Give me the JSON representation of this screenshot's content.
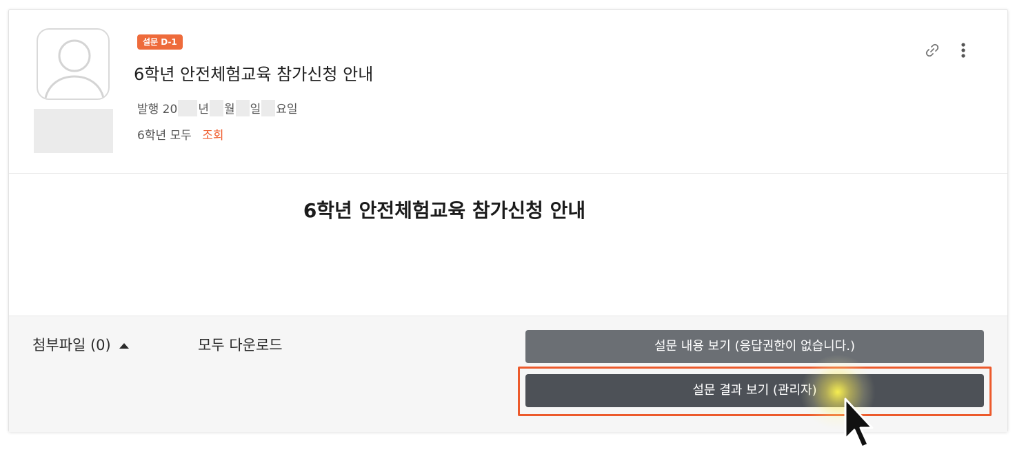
{
  "post": {
    "badge": "설문 D-1",
    "title": "6학년 안전체험교육 참가신청 안내",
    "meta": {
      "prefix": "발행 20",
      "year_suffix": "년",
      "month_suffix": "월",
      "day_suffix": "일",
      "weekday_suffix": "요일"
    },
    "audience": "6학년 모두",
    "views_label": "조회"
  },
  "body": {
    "heading": "6학년 안전체험교육 참가신청 안내"
  },
  "footer": {
    "attachments_label": "첨부파일 (0)",
    "download_all_label": "모두 다운로드",
    "view_survey_button": "설문 내용 보기 (응답권한이 없습니다.)",
    "view_results_button": "설문 결과 보기 (관리자)"
  },
  "icons": {
    "link": "link-icon",
    "more": "more-vertical-icon",
    "expand": "caret-up-icon",
    "avatar": "user-avatar-icon",
    "cursor": "mouse-pointer-icon"
  },
  "colors": {
    "accent": "#ee6b3b",
    "highlight": "#ec5a2c",
    "button_secondary": "#6b6f74",
    "button_primary": "#4d5157"
  }
}
